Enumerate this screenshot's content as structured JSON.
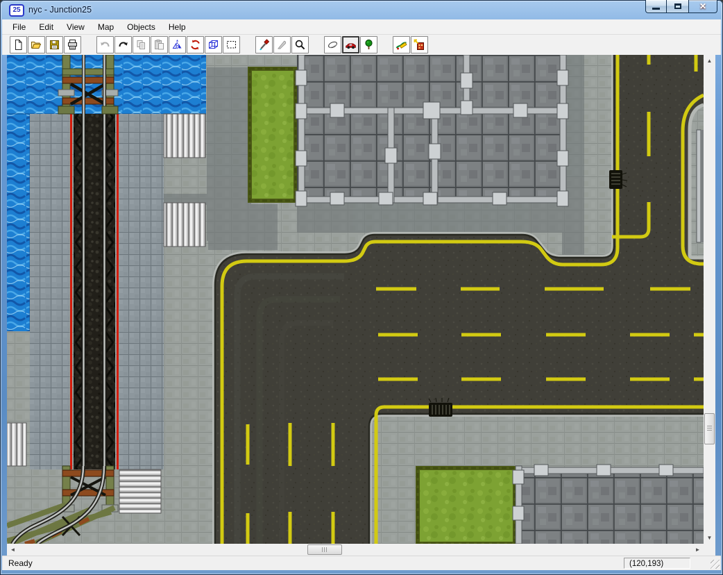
{
  "window": {
    "title": "nyc - Junction25",
    "icon_label": "25",
    "controls": [
      "minimize",
      "maximize",
      "close"
    ]
  },
  "menu": {
    "items": [
      "File",
      "Edit",
      "View",
      "Map",
      "Objects",
      "Help"
    ]
  },
  "toolbar": {
    "buttons": [
      {
        "name": "new-file",
        "state": "enabled"
      },
      {
        "name": "open-file",
        "state": "enabled"
      },
      {
        "name": "save-file",
        "state": "enabled"
      },
      {
        "name": "print",
        "state": "enabled"
      },
      {
        "name": "undo",
        "state": "disabled"
      },
      {
        "name": "redo",
        "state": "enabled"
      },
      {
        "name": "copy",
        "state": "disabled"
      },
      {
        "name": "paste",
        "state": "disabled"
      },
      {
        "name": "flip",
        "state": "enabled"
      },
      {
        "name": "rotate",
        "state": "enabled"
      },
      {
        "name": "perspective-box",
        "state": "enabled"
      },
      {
        "name": "select-marquee",
        "state": "enabled"
      },
      {
        "name": "eyedropper",
        "state": "enabled"
      },
      {
        "name": "knife",
        "state": "disabled"
      },
      {
        "name": "magnifier",
        "state": "enabled"
      },
      {
        "name": "eraser",
        "state": "enabled"
      },
      {
        "name": "vehicle",
        "state": "active"
      },
      {
        "name": "tree",
        "state": "enabled"
      },
      {
        "name": "terrain-paint",
        "state": "enabled"
      },
      {
        "name": "place-building",
        "state": "enabled"
      }
    ]
  },
  "statusbar": {
    "message": "Ready",
    "coordinates": "(120,193)"
  },
  "map": {
    "features": [
      "water",
      "rail-bridge-top",
      "railroad-track",
      "rail-bridge-bottom",
      "platform-tiles",
      "striped-platforms",
      "sidewalk",
      "grass-park-top",
      "grass-park-bottom",
      "building-top",
      "building-bottom-right",
      "right-city-block",
      "road-network",
      "yellow-lane-markings",
      "storm-drains"
    ],
    "colors": {
      "water": "#1d7fd2",
      "grass": "#7da233",
      "sidewalk": "#9aa09c",
      "road": "#403f38",
      "lane_yellow": "#d2ca12",
      "track_red": "#d41c0c",
      "bridge_green": "#75804a",
      "roof_gray": "#7d8183"
    }
  },
  "chrome_colors": {
    "titlebar_blue": "#6596cc",
    "close_red": "#c0402c"
  }
}
